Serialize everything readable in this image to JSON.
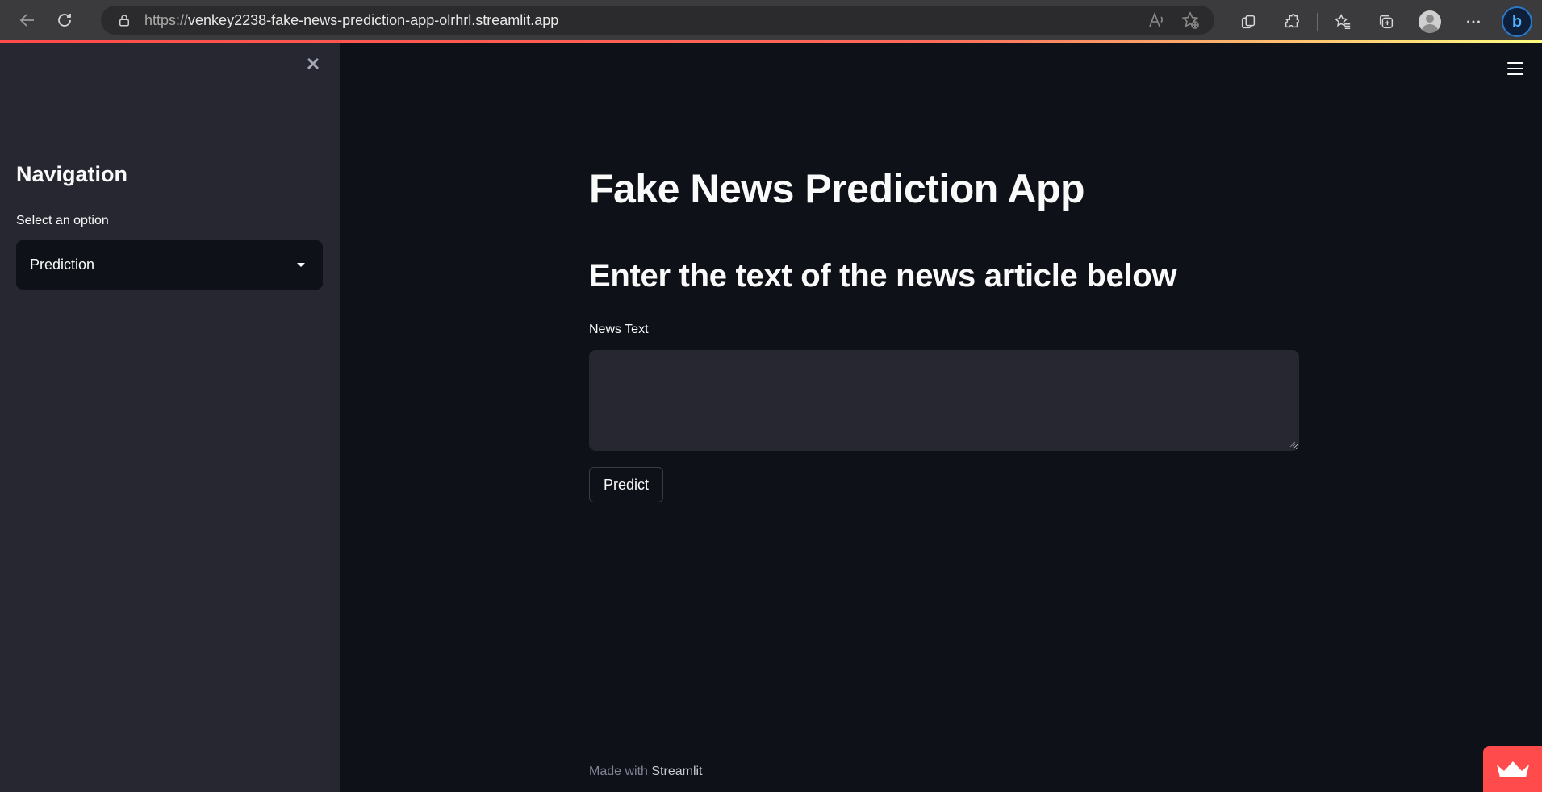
{
  "browser": {
    "url_prefix": "https://",
    "url_host": "venkey2238-fake-news-prediction-app-olrhrl.streamlit.app",
    "bing_label": "b"
  },
  "sidebar": {
    "title": "Navigation",
    "select_label": "Select an option",
    "select_value": "Prediction"
  },
  "main": {
    "title": "Fake News Prediction App",
    "subheader": "Enter the text of the news article below",
    "field_label": "News Text",
    "textarea_value": "",
    "predict_label": "Predict"
  },
  "footer": {
    "prefix": "Made with",
    "brand": "Streamlit"
  },
  "colors": {
    "background": "#0e1117",
    "sidebar": "#262730",
    "accent": "#ff4b4b",
    "text": "#fafafa"
  }
}
